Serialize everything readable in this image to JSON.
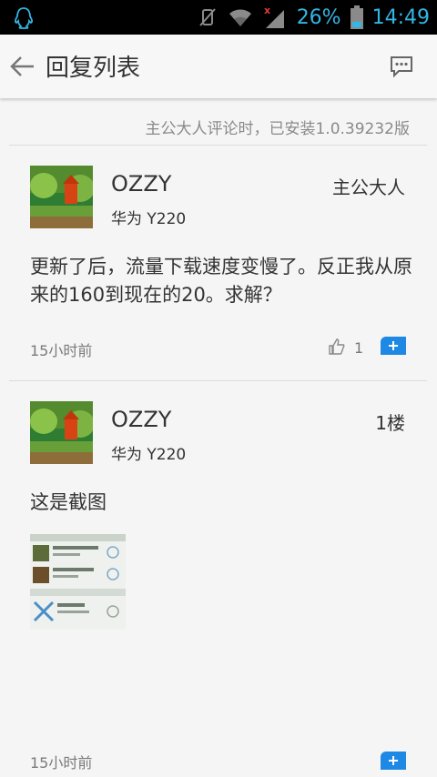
{
  "status": {
    "battery": "26%",
    "time": "14:49"
  },
  "header": {
    "title": "回复列表"
  },
  "install_info": "主公大人评论时，已安装1.0.39232版",
  "posts": [
    {
      "user": "OZZY",
      "device": "华为 Y220",
      "tag": "主公大人",
      "content": "更新了后，流量下载速度变慢了。反正我从原来的160到现在的20。求解？",
      "time": "15小时前",
      "likes": "1"
    },
    {
      "user": "OZZY",
      "device": "华为 Y220",
      "tag": "1楼",
      "content": "这是截图",
      "time": "15小时前"
    }
  ],
  "colors": {
    "accent": "#1e88e5",
    "statusbar_text": "#33b5e5"
  }
}
